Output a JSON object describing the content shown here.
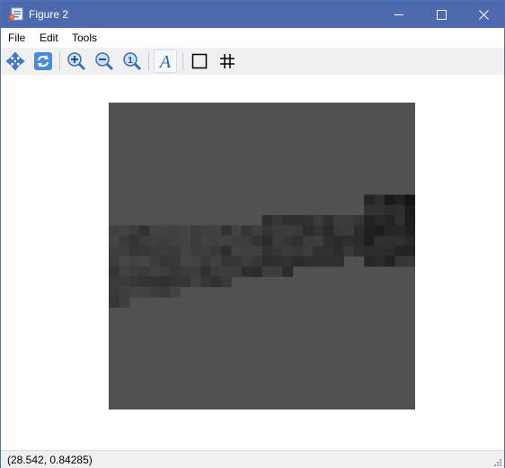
{
  "window": {
    "title": "Figure 2",
    "title_color": "#4d6aaf"
  },
  "menu": {
    "items": [
      "File",
      "Edit",
      "Tools"
    ]
  },
  "toolbar": {
    "tools": [
      {
        "name": "pan-icon",
        "label": "Pan"
      },
      {
        "name": "reset-icon",
        "label": "Reset view"
      },
      {
        "name": "zoom-in-icon",
        "label": "Zoom in"
      },
      {
        "name": "zoom-out-icon",
        "label": "Zoom out"
      },
      {
        "name": "zoom-one-icon",
        "label": "Zoom to 1:1"
      },
      {
        "name": "font-icon",
        "label": "Text"
      },
      {
        "name": "square-icon",
        "label": "Rectangle"
      },
      {
        "name": "grid-icon",
        "label": "Grid"
      }
    ]
  },
  "image": {
    "background_color": "#515151",
    "description_colors": {
      "light": "#555555",
      "mid": "#4a4a4a",
      "dark": "#2a2a2a",
      "darkest": "#111111"
    }
  },
  "status": {
    "coordinates": "(28.542, 0.84285)"
  }
}
